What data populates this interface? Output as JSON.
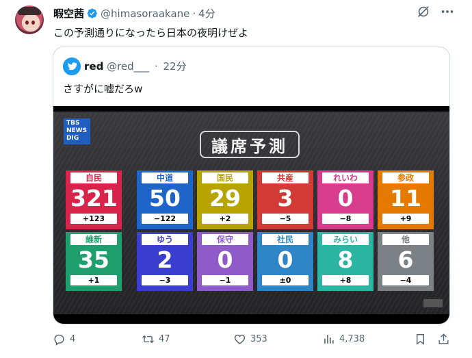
{
  "tweet": {
    "display_name": "暇空茜",
    "handle": "@himasoraakane",
    "dot": "·",
    "time": "4分",
    "text": "この予測通りになったら日本の夜明けぜよ"
  },
  "quoted": {
    "display_name": "red",
    "handle": "@red___",
    "dot": "·",
    "time": "22分",
    "text": "さすがに嘘だろw"
  },
  "media": {
    "logo_text": [
      "TBS",
      "NEWS",
      "DIG"
    ],
    "title": "議席予測",
    "parties": [
      {
        "name": "自民",
        "seats": "321",
        "change": "+123",
        "color": "#d8244a"
      },
      {
        "name": "中道",
        "seats": "50",
        "change": "−122",
        "color": "#1f64c8"
      },
      {
        "name": "国民",
        "seats": "29",
        "change": "+2",
        "color": "#b7a400"
      },
      {
        "name": "共産",
        "seats": "3",
        "change": "−5",
        "color": "#d23a36"
      },
      {
        "name": "れいわ",
        "seats": "0",
        "change": "−8",
        "color": "#d83c8c"
      },
      {
        "name": "参政",
        "seats": "11",
        "change": "+9",
        "color": "#e57a00"
      },
      {
        "name": "維新",
        "seats": "35",
        "change": "+1",
        "color": "#1f9e6e"
      },
      {
        "name": "ゆう",
        "seats": "2",
        "change": "−3",
        "color": "#3b3fd0"
      },
      {
        "name": "保守",
        "seats": "0",
        "change": "−1",
        "color": "#8e5bc8"
      },
      {
        "name": "社民",
        "seats": "0",
        "change": "±0",
        "color": "#2f86c6"
      },
      {
        "name": "みらい",
        "seats": "8",
        "change": "+8",
        "color": "#2bb5a2"
      },
      {
        "name": "他",
        "seats": "6",
        "change": "−4",
        "color": "#7b8184"
      }
    ]
  },
  "actions": {
    "replies": "4",
    "reposts": "47",
    "likes": "353",
    "views": "4,738"
  },
  "colors": {
    "verified": "#1d9bf0",
    "muted_text": "#536471",
    "border": "#cfd9de"
  },
  "icons": {
    "verified": "verified-badge-icon",
    "grok": "grok-icon",
    "more": "more-icon",
    "reply": "reply-icon",
    "repost": "repost-icon",
    "like": "heart-icon",
    "views": "views-icon",
    "bookmark": "bookmark-icon",
    "share": "share-icon"
  }
}
